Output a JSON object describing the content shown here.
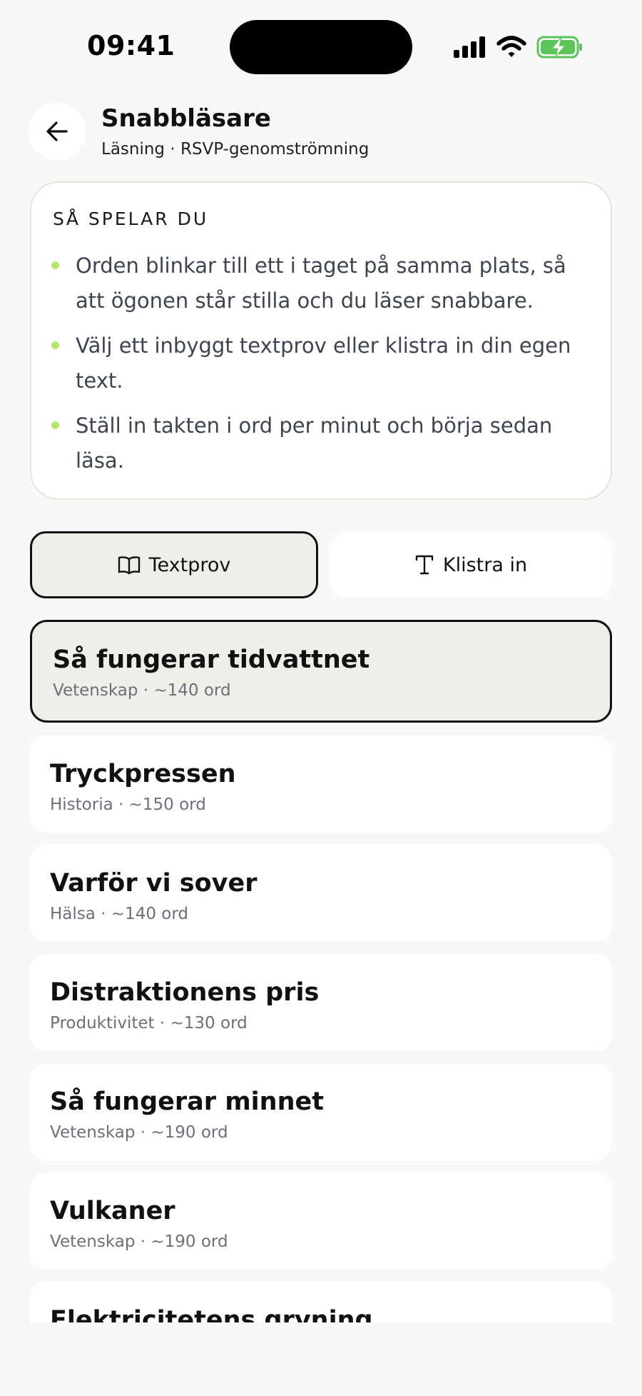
{
  "status_bar": {
    "time": "09:41"
  },
  "header": {
    "back_icon": "arrow-left-icon",
    "title": "Snabbläsare",
    "subtitle": "Läsning · RSVP-genomströmning"
  },
  "how_to": {
    "heading": "SÅ SPELAR DU",
    "bullets": [
      "Orden blinkar till ett i taget på samma plats, så att ögonen står stilla och du läser snabbare.",
      "Välj ett inbyggt textprov eller klistra in din egen text.",
      "Ställ in takten i ord per minut och börja sedan läsa."
    ],
    "bullet_color": "#b8e86b"
  },
  "tabs": {
    "samples": {
      "label": "Textprov",
      "icon": "book-open-icon",
      "selected": true
    },
    "paste": {
      "label": "Klistra in",
      "icon": "text-type-icon",
      "selected": false
    }
  },
  "texts": [
    {
      "title": "Så fungerar tidvattnet",
      "meta": "Vetenskap · ~140 ord",
      "selected": true
    },
    {
      "title": "Tryckpressen",
      "meta": "Historia · ~150 ord",
      "selected": false
    },
    {
      "title": "Varför vi sover",
      "meta": "Hälsa · ~140 ord",
      "selected": false
    },
    {
      "title": "Distraktionens pris",
      "meta": "Produktivitet · ~130 ord",
      "selected": false
    },
    {
      "title": "Så fungerar minnet",
      "meta": "Vetenskap · ~190 ord",
      "selected": false
    },
    {
      "title": "Vulkaner",
      "meta": "Vetenskap · ~190 ord",
      "selected": false
    },
    {
      "title": "Elektricitetens gryning",
      "meta": "",
      "selected": false
    }
  ]
}
